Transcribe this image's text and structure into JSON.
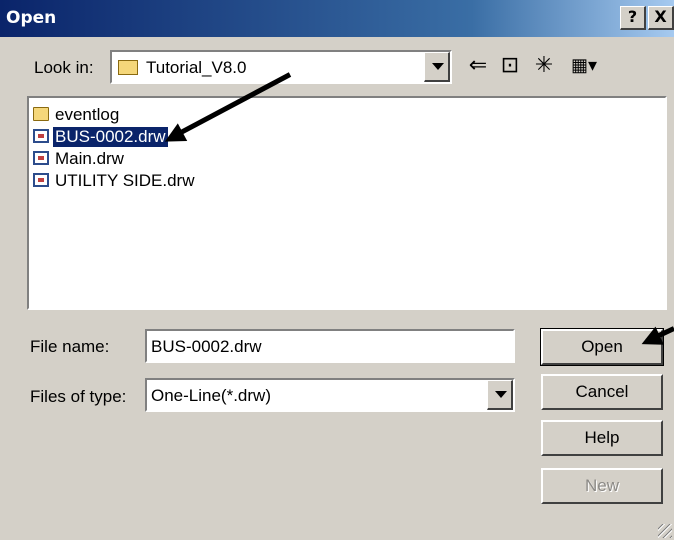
{
  "dialog": {
    "title": "Open",
    "help_glyph": "?",
    "close_glyph": "X"
  },
  "look_in": {
    "label": "Look in:",
    "value": "Tutorial_V8.0",
    "icon": "folder-icon"
  },
  "toolbar": {
    "back_icon": "back-arrow-icon",
    "back_glyph": "⇐",
    "up_icon": "up-folder-icon",
    "up_glyph": "⊡",
    "new_folder_icon": "new-folder-icon",
    "new_folder_glyph": "✳",
    "view_menu_icon": "view-menu-icon",
    "view_glyph": "▦▾"
  },
  "files": [
    {
      "name": "eventlog",
      "type": "folder",
      "selected": false
    },
    {
      "name": "BUS-0002.drw",
      "type": "drw",
      "selected": true
    },
    {
      "name": "Main.drw",
      "type": "drw",
      "selected": false
    },
    {
      "name": "UTILITY SIDE.drw",
      "type": "drw",
      "selected": false
    }
  ],
  "file_name": {
    "label": "File name:",
    "value": "BUS-0002.drw"
  },
  "file_type": {
    "label": "Files of type:",
    "value": "One-Line(*.drw)"
  },
  "buttons": {
    "open": "Open",
    "cancel": "Cancel",
    "help": "Help",
    "new": "New"
  },
  "colors": {
    "titlebar": "#0a246a",
    "selection": "#0a246a",
    "face": "#d4d0c8",
    "annotation_arrow": "#000000"
  }
}
